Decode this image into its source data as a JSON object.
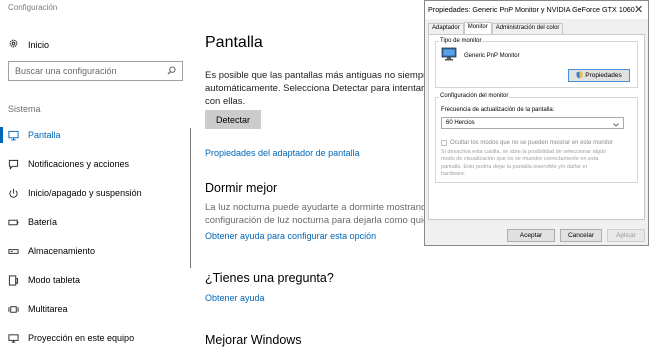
{
  "settings": {
    "app_title": "Configuración",
    "home_label": "Inicio",
    "search_placeholder": "Buscar una configuración",
    "section_label": "Sistema",
    "nav": [
      {
        "label": "Pantalla",
        "icon": "monitor-icon",
        "active": true
      },
      {
        "label": "Notificaciones y acciones",
        "icon": "notification-icon"
      },
      {
        "label": "Inicio/apagado y suspensión",
        "icon": "power-icon"
      },
      {
        "label": "Batería",
        "icon": "battery-icon"
      },
      {
        "label": "Almacenamiento",
        "icon": "storage-icon"
      },
      {
        "label": "Modo tableta",
        "icon": "tablet-icon"
      },
      {
        "label": "Multitarea",
        "icon": "multitask-icon"
      },
      {
        "label": "Proyección en este equipo",
        "icon": "projection-icon"
      }
    ]
  },
  "main": {
    "title": "Pantalla",
    "intro_lines": [
      "Es posible que las pantallas más antiguas no siempre s",
      "automáticamente. Selecciona Detectar para intentar la",
      "con ellas."
    ],
    "detect_button": "Detectar",
    "adapter_link": "Propiedades del adaptador de pantalla",
    "sleep_title": "Dormir mejor",
    "sleep_lines": [
      "La luz nocturna puede ayudarte a dormirte mostrando",
      "configuración de luz nocturna para dejarla como quier"
    ],
    "sleep_link": "Obtener ayuda para configurar esta opción",
    "question_title": "¿Tienes una pregunta?",
    "help_link": "Obtener ayuda",
    "improve_title": "Mejorar Windows"
  },
  "dialog": {
    "title": "Propiedades: Generic PnP Monitor y NVIDIA GeForce GTX 1060",
    "tabs": [
      "Adaptador",
      "Monitor",
      "Administración del color"
    ],
    "selected_tab": "Monitor",
    "monitor_type_group": "Tipo de monitor",
    "monitor_name": "Generic PnP Monitor",
    "properties_button": "Propiedades",
    "monitor_settings_group": "Configuración del monitor",
    "refresh_label": "Frecuencia de actualización de la pantalla:",
    "refresh_value": "60 Hercios",
    "hide_modes_label": "Ocultar los modos que no se pueden mostrar en este monitor",
    "hide_modes_desc": [
      "Si desactiva esta casilla, se abre la posibilidad de seleccionar algún",
      "modo de visualización que no se muestre correctamente en esta",
      "pantalla. Esto podría dejar la pantalla inservible y/o dañar el",
      "hardware."
    ],
    "ok": "Aceptar",
    "cancel": "Cancelar",
    "apply": "Aplicar"
  }
}
